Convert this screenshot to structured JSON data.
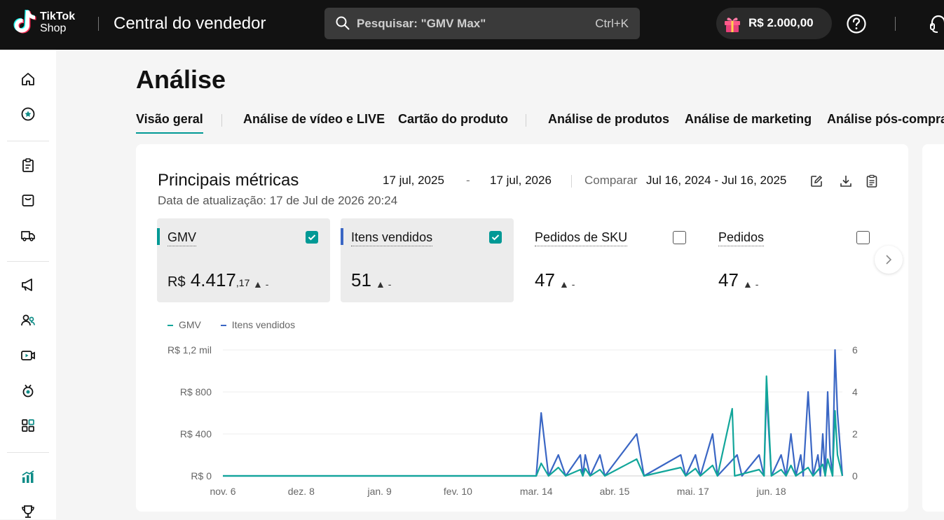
{
  "topbar": {
    "logo_line1": "TikTok",
    "logo_line2": "Shop",
    "app_title": "Central do vendedor",
    "search_placeholder": "Pesquisar: \"GMV Max\"",
    "search_shortcut": "Ctrl+K",
    "balance": "R$ 2.000,00"
  },
  "sidebar": {
    "items": [
      "home-icon",
      "star-badge-icon",
      "clipboard-icon",
      "shopping-bag-icon",
      "delivery-truck-icon",
      "megaphone-icon",
      "users-icon",
      "video-icon",
      "medal-icon",
      "apps-grid-icon",
      "analytics-chart-icon",
      "trophy-icon"
    ]
  },
  "page": {
    "title": "Análise",
    "tabs": [
      {
        "label": "Visão geral",
        "active": true
      },
      {
        "label": "Análise de vídeo e LIVE",
        "active": false
      },
      {
        "label": "Cartão do produto",
        "active": false
      },
      {
        "label": "Análise de produtos",
        "active": false
      },
      {
        "label": "Análise de marketing",
        "active": false
      },
      {
        "label": "Análise pós-compra",
        "active": false
      }
    ]
  },
  "card": {
    "title": "Principais métricas",
    "updated": "Data de atualização: 17 de Jul de 2026 20:24",
    "date_start": "17 jul, 2025",
    "date_dash": "-",
    "date_end": "17 jul, 2026",
    "compare_label": "Comparar",
    "compare_range": "Jul 16, 2024 - Jul 16, 2025",
    "metrics": [
      {
        "name": "GMV",
        "currency": "R$",
        "value": "4.417",
        "cents": ",17",
        "trend": "▲ -",
        "selected": true,
        "color": "#009995"
      },
      {
        "name": "Itens vendidos",
        "value": "51",
        "trend": "▲ -",
        "selected": true,
        "color": "#3a66c4"
      },
      {
        "name": "Pedidos de SKU",
        "value": "47",
        "trend": "▲ -",
        "selected": false
      },
      {
        "name": "Pedidos",
        "value": "47",
        "trend": "▲ -",
        "selected": false
      }
    ]
  },
  "chart_data": {
    "type": "line",
    "legend": [
      "GMV",
      "Itens vendidos"
    ],
    "colors": {
      "GMV": "#12a69a",
      "Itens vendidos": "#3a66c4"
    },
    "x_tick_labels": [
      "nov. 6",
      "dez. 8",
      "jan. 9",
      "fev. 10",
      "mar. 14",
      "abr. 15",
      "mai. 17",
      "jun. 18"
    ],
    "y_left_ticks": [
      "R$ 0",
      "R$ 400",
      "R$ 800",
      "R$ 1,2 mil"
    ],
    "y_left_range": [
      0,
      1200
    ],
    "y_right_ticks": [
      "0",
      "2",
      "4",
      "6"
    ],
    "y_right_range": [
      0,
      6
    ],
    "grid": true,
    "legend_position": "top-left",
    "series": [
      {
        "name": "Itens vendidos",
        "axis": "right",
        "points": [
          [
            "nov. 6",
            0
          ],
          [
            "mar. 14",
            0
          ],
          [
            "mar. 16",
            3
          ],
          [
            "mar. 19",
            0
          ],
          [
            "mar. 23",
            1
          ],
          [
            "mar. 26",
            0
          ],
          [
            "abr. 1",
            1
          ],
          [
            "abr. 2",
            0
          ],
          [
            "abr. 3",
            1
          ],
          [
            "abr. 5",
            0
          ],
          [
            "abr. 9",
            1
          ],
          [
            "abr. 11",
            0
          ],
          [
            "abr. 24",
            2
          ],
          [
            "abr. 27",
            0
          ],
          [
            "mai. 12",
            1
          ],
          [
            "mai. 14",
            0
          ],
          [
            "mai. 18",
            1
          ],
          [
            "mai. 20",
            0
          ],
          [
            "mai. 25",
            2
          ],
          [
            "mai. 27",
            0
          ],
          [
            "jun. 4",
            1
          ],
          [
            "jun. 6",
            0
          ],
          [
            "jun. 13",
            1
          ],
          [
            "jun. 15",
            0
          ],
          [
            "jun. 16",
            4
          ],
          [
            "jun. 18",
            0
          ],
          [
            "jun. 22",
            1
          ],
          [
            "jun. 24",
            0
          ],
          [
            "jun. 26",
            2
          ],
          [
            "jun. 28",
            0
          ],
          [
            "jun. 30",
            1
          ],
          [
            "jul. 1",
            0
          ],
          [
            "jul. 3",
            4
          ],
          [
            "jul. 5",
            0
          ],
          [
            "jul. 7",
            1
          ],
          [
            "jul. 8",
            0
          ],
          [
            "jul. 9",
            2
          ],
          [
            "jul. 10",
            0
          ],
          [
            "jul. 11",
            4
          ],
          [
            "jul. 12",
            1
          ],
          [
            "jul. 13",
            0
          ],
          [
            "jul. 14",
            6
          ],
          [
            "jul. 15",
            3
          ],
          [
            "jul. 17",
            0
          ]
        ]
      },
      {
        "name": "GMV",
        "axis": "left",
        "points": [
          [
            "nov. 6",
            0
          ],
          [
            "mar. 14",
            0
          ],
          [
            "mar. 16",
            120
          ],
          [
            "mar. 19",
            0
          ],
          [
            "mar. 23",
            80
          ],
          [
            "mar. 26",
            0
          ],
          [
            "abr. 1",
            60
          ],
          [
            "abr. 2",
            0
          ],
          [
            "abr. 3",
            70
          ],
          [
            "abr. 5",
            0
          ],
          [
            "abr. 9",
            60
          ],
          [
            "abr. 11",
            0
          ],
          [
            "abr. 24",
            160
          ],
          [
            "abr. 27",
            0
          ],
          [
            "mai. 12",
            80
          ],
          [
            "mai. 14",
            0
          ],
          [
            "mai. 18",
            70
          ],
          [
            "mai. 20",
            0
          ],
          [
            "mai. 25",
            100
          ],
          [
            "mai. 27",
            0
          ],
          [
            "jun. 2",
            640
          ],
          [
            "jun. 3",
            0
          ],
          [
            "jun. 13",
            60
          ],
          [
            "jun. 15",
            0
          ],
          [
            "jun. 16",
            950
          ],
          [
            "jun. 18",
            0
          ],
          [
            "jun. 22",
            60
          ],
          [
            "jun. 24",
            0
          ],
          [
            "jun. 26",
            100
          ],
          [
            "jun. 28",
            0
          ],
          [
            "jul. 3",
            80
          ],
          [
            "jul. 5",
            0
          ],
          [
            "jul. 9",
            110
          ],
          [
            "jul. 10",
            0
          ],
          [
            "jul. 11",
            160
          ],
          [
            "jul. 13",
            0
          ],
          [
            "jul. 14",
            620
          ],
          [
            "jul. 15",
            200
          ],
          [
            "jul. 17",
            0
          ]
        ]
      }
    ]
  }
}
